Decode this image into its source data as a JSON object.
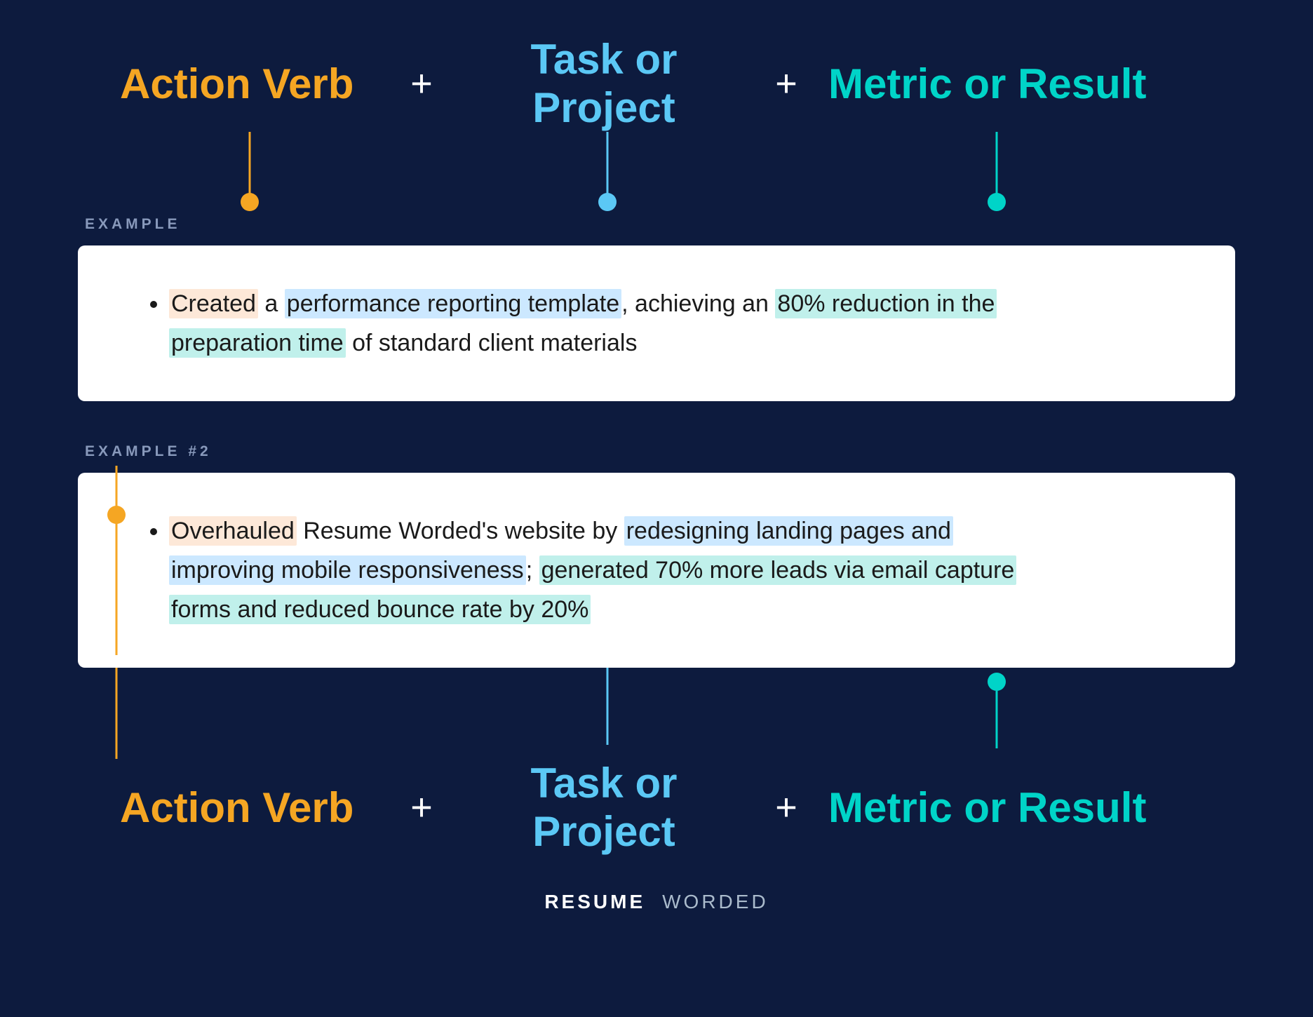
{
  "colors": {
    "orange": "#f5a623",
    "blue": "#5bc8f5",
    "teal": "#00d4c8",
    "white": "#ffffff",
    "background": "#0d1b3e"
  },
  "formula": {
    "action_verb": "Action Verb",
    "task_or_project": "Task or Project",
    "metric_or_result": "Metric or Result",
    "plus": "+"
  },
  "example1": {
    "label": "EXAMPLE",
    "text_parts": {
      "action": "Created",
      "connector1": " a ",
      "task": "performance reporting template",
      "connector2": ", achieving an ",
      "metric": "80% reduction in the preparation time",
      "connector3": " of standard client materials"
    }
  },
  "example2": {
    "label": "EXAMPLE #2",
    "text_parts": {
      "action": "Overhauled",
      "connector1": " Resume Worded's website by ",
      "task": "redesigning landing pages and improving mobile responsiveness",
      "connector2": "; ",
      "metric": "generated 70% more leads via email capture forms and reduced bounce rate by 20%",
      "connector3": ""
    }
  },
  "brand": {
    "resume": "RESUME",
    "worded": "WORDED"
  }
}
